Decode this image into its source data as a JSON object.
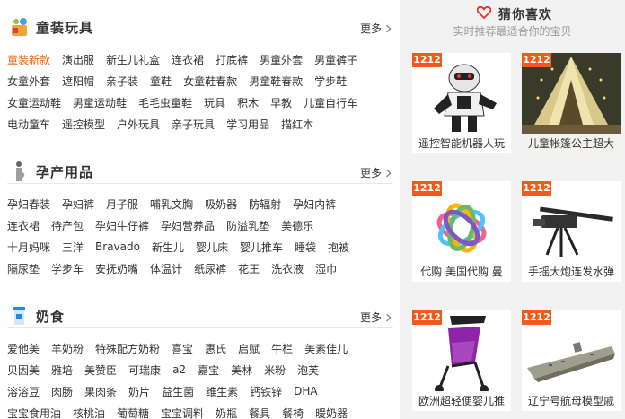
{
  "sections": [
    {
      "title": "童装玩具",
      "more": "更多",
      "rows": [
        [
          "童装新款",
          "演出服",
          "新生儿礼盒",
          "连衣裙",
          "打底裤",
          "男童外套",
          "男童裤子"
        ],
        [
          "女童外套",
          "遮阳帽",
          "亲子装",
          "童鞋",
          "女童鞋春款",
          "男童鞋春款",
          "学步鞋"
        ],
        [
          "女童运动鞋",
          "男童运动鞋",
          "毛毛虫童鞋",
          "玩具",
          "积木",
          "早教",
          "儿童自行车"
        ],
        [
          "电动童车",
          "遥控模型",
          "户外玩具",
          "亲子玩具",
          "学习用品",
          "描红本"
        ]
      ]
    },
    {
      "title": "孕产用品",
      "more": "更多",
      "rows": [
        [
          "孕妇春装",
          "孕妇裤",
          "月子服",
          "哺乳文胸",
          "吸奶器",
          "防辐射",
          "孕妇内裤"
        ],
        [
          "连衣裙",
          "待产包",
          "孕妇牛仔裤",
          "孕妇营养品",
          "防溢乳垫",
          "美德乐"
        ],
        [
          "十月妈咪",
          "三洋",
          "Bravado",
          "新生儿",
          "婴儿床",
          "婴儿推车",
          "睡袋",
          "抱被"
        ],
        [
          "隔尿垫",
          "学步车",
          "安抚奶嘴",
          "体温计",
          "纸尿裤",
          "花王",
          "洗衣液",
          "湿巾"
        ]
      ]
    },
    {
      "title": "奶食",
      "more": "更多",
      "rows": [
        [
          "爱他美",
          "羊奶粉",
          "特殊配方奶粉",
          "喜宝",
          "惠氏",
          "启赋",
          "牛栏",
          "美素佳儿"
        ],
        [
          "贝因美",
          "雅培",
          "美赞臣",
          "可瑞康",
          "a2",
          "嘉宝",
          "美林",
          "米粉",
          "泡芙"
        ],
        [
          "溶溶豆",
          "肉肠",
          "果肉条",
          "奶片",
          "益生菌",
          "维生素",
          "钙铁锌",
          "DHA"
        ],
        [
          "宝宝食用油",
          "核桃油",
          "葡萄糖",
          "宝宝调料",
          "奶瓶",
          "餐具",
          "餐椅",
          "暖奶器"
        ]
      ]
    }
  ],
  "guess": {
    "title": "猜你喜欢",
    "subtitle": "实时推荐最适合你的宝贝",
    "items": [
      {
        "badge": "1212",
        "caption": "遥控智能机器人玩"
      },
      {
        "badge": "1212",
        "caption": "儿童帐篷公主超大"
      },
      {
        "badge": "1212",
        "caption": "代购 美国代购 曼"
      },
      {
        "badge": "1212",
        "caption": "手摇大炮连发水弹"
      },
      {
        "badge": "1212",
        "caption": "欧洲超轻便婴儿推"
      },
      {
        "badge": "1212",
        "caption": "辽宁号航母模型戚"
      }
    ]
  },
  "colors": {
    "accent": "#e8641b",
    "badge": "#f25a1b",
    "heart": "#e8312a"
  }
}
